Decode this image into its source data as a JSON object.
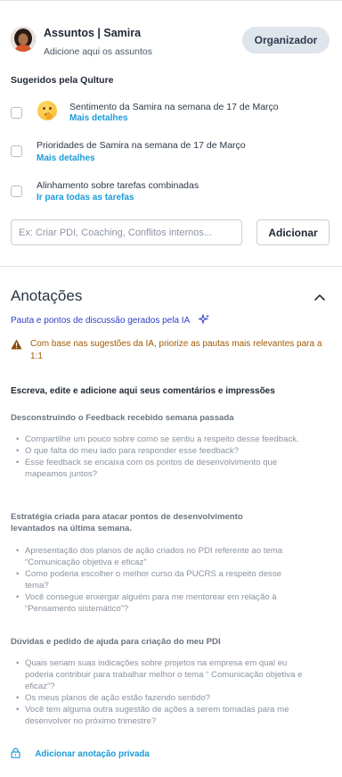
{
  "header": {
    "title": "Assuntos | Samira",
    "subtitle": "Adicione aqui os assuntos",
    "organizer_button": "Organizador"
  },
  "suggestions": {
    "title": "Sugeridos pela Qulture",
    "items": [
      {
        "text": "Sentimento da Samira na semana de 17 de Março",
        "link": "Mais detalhes",
        "icon": "thinking-face-emoji"
      },
      {
        "text": "Prioridades de Samira na semana de 17 de Março",
        "link": "Mais detalhes"
      },
      {
        "text": "Alinhamento sobre tarefas combinadas",
        "link": "Ir para todas as tarefas"
      }
    ]
  },
  "add_topic": {
    "placeholder": "Ex: Criar PDI, Coaching, Conflitos internos...",
    "value": "",
    "button": "Adicionar"
  },
  "notes": {
    "title": "Anotações",
    "ai_label": "Pauta e pontos de discussão gerados pela IA",
    "warning": "Com base nas sugestões da IA, priorize as pautas mais relevantes para a 1:1",
    "instruction": "Escreva, edite e adicione aqui seus comentários e impressões",
    "sections": [
      {
        "title": "Desconstruindo o Feedback recebido semana passada",
        "bullets": [
          "Compartilhe um pouco sobre como se sentiu a respeito desse feedback.",
          "O que falta do meu lado para responder esse feedback?",
          "Esse feedback se encaixa com os pontos de desenvolvimento que mapeamos juntos?"
        ]
      },
      {
        "title": "Estratégia criada para atacar pontos de desenvolvimento levantados na última semana.",
        "bullets": [
          "Apresentação dos planos de ação criados no PDI referente ao tema “Comunicação objetiva e eficaz”",
          "Como poderia escolher o melhor curso da PUCRS a respeito desse tema?",
          "Você consegue enxergar alguém para me mentorear em relação à “Pensamento sistemático”?"
        ]
      },
      {
        "title": "Dúvidas e pedido de ajuda para criação do meu PDI",
        "bullets": [
          "Quais seriam suas indicações sobre projetos na empresa em qual eu poderia contribuir para trabalhar melhor o tema “ Comunicação objetiva e eficaz”?",
          "Os meus planos de ação estão fazendo sentido?",
          "Você tem alguma outra sugestão de ações a serem tomadas para me desenvolver no próximo trimestre?"
        ]
      }
    ],
    "private_note": "Adicionar anotação privada"
  },
  "colors": {
    "link_blue": "#1c9bd8",
    "ai_blue": "#2c3ec9",
    "warning_orange": "#a05a00",
    "organizer_bg": "#dfe5ec"
  }
}
